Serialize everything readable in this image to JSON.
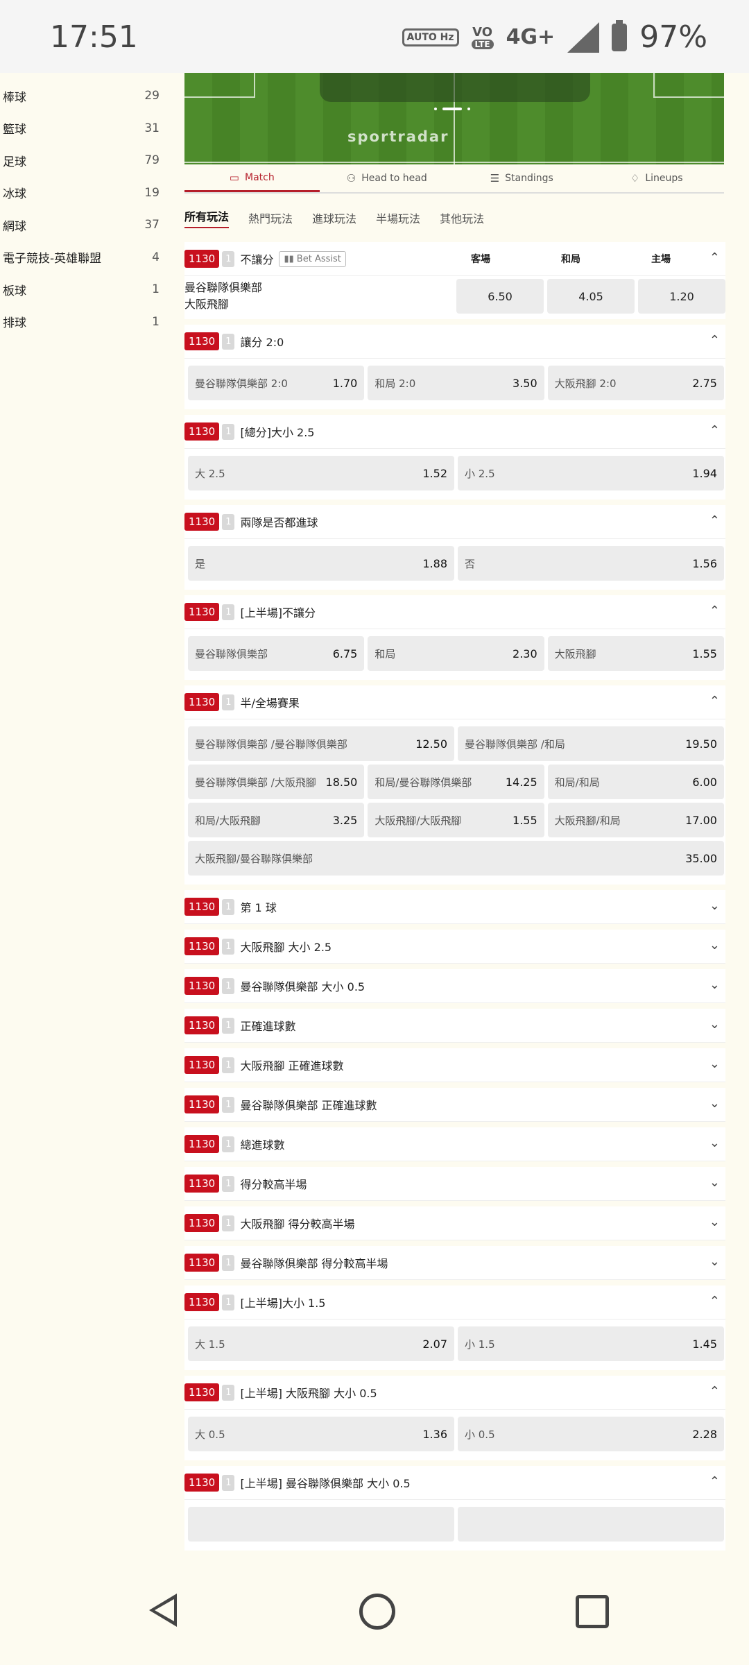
{
  "status_bar": {
    "time": "17:51",
    "auto_hz": "AUTO Hz",
    "vo_lte": "VO",
    "lte": "LTE",
    "network": "4G+",
    "battery": "97%"
  },
  "sidebar": {
    "items": [
      {
        "label": "棒球",
        "count": "29"
      },
      {
        "label": "籃球",
        "count": "31"
      },
      {
        "label": "足球",
        "count": "79"
      },
      {
        "label": "冰球",
        "count": "19"
      },
      {
        "label": "網球",
        "count": "37"
      },
      {
        "label": "電子競技-英雄聯盟",
        "count": "4"
      },
      {
        "label": "板球",
        "count": "1"
      },
      {
        "label": "排球",
        "count": "1"
      }
    ]
  },
  "tracker": {
    "brand": "sportradar"
  },
  "tabs": [
    {
      "label": "Match",
      "icon": "pitch-icon"
    },
    {
      "label": "Head to head",
      "icon": "people-icon"
    },
    {
      "label": "Standings",
      "icon": "table-icon"
    },
    {
      "label": "Lineups",
      "icon": "shirt-icon"
    }
  ],
  "categories": [
    "所有玩法",
    "熱門玩法",
    "進球玩法",
    "半場玩法",
    "其他玩法"
  ],
  "match": {
    "code": "1130",
    "num": "1",
    "market": "不讓分",
    "bet_assist": "Bet Assist",
    "columns": [
      "客場",
      "和局",
      "主場"
    ],
    "team1": "曼谷聯隊俱樂部",
    "team2": "大阪飛腳",
    "odds": [
      "6.50",
      "4.05",
      "1.20"
    ]
  },
  "sections": [
    {
      "code": "1130",
      "num": "1",
      "title": "讓分 2:0",
      "open": true,
      "rows": [
        [
          {
            "l": "曼谷聯隊俱樂部 2:0",
            "v": "1.70"
          },
          {
            "l": "和局 2:0",
            "v": "3.50"
          },
          {
            "l": "大阪飛腳 2:0",
            "v": "2.75"
          }
        ]
      ]
    },
    {
      "code": "1130",
      "num": "1",
      "title": "[總分]大小 2.5",
      "open": true,
      "rows": [
        [
          {
            "l": "大 2.5",
            "v": "1.52"
          },
          {
            "l": "小 2.5",
            "v": "1.94"
          }
        ]
      ]
    },
    {
      "code": "1130",
      "num": "1",
      "title": "兩隊是否都進球",
      "open": true,
      "rows": [
        [
          {
            "l": "是",
            "v": "1.88"
          },
          {
            "l": "否",
            "v": "1.56"
          }
        ]
      ]
    },
    {
      "code": "1130",
      "num": "1",
      "title": "[上半場]不讓分",
      "open": true,
      "rows": [
        [
          {
            "l": "曼谷聯隊俱樂部",
            "v": "6.75"
          },
          {
            "l": "和局",
            "v": "2.30"
          },
          {
            "l": "大阪飛腳",
            "v": "1.55"
          }
        ]
      ]
    },
    {
      "code": "1130",
      "num": "1",
      "title": "半/全場賽果",
      "open": true,
      "rows": [
        [
          {
            "l": "曼谷聯隊俱樂部 /曼谷聯隊俱樂部",
            "v": "12.50"
          },
          {
            "l": "曼谷聯隊俱樂部 /和局",
            "v": "19.50"
          }
        ],
        [
          {
            "l": "曼谷聯隊俱樂部 /大阪飛腳",
            "v": "18.50"
          },
          {
            "l": "和局/曼谷聯隊俱樂部",
            "v": "14.25"
          },
          {
            "l": "和局/和局",
            "v": "6.00"
          }
        ],
        [
          {
            "l": "和局/大阪飛腳",
            "v": "3.25"
          },
          {
            "l": "大阪飛腳/大阪飛腳",
            "v": "1.55"
          },
          {
            "l": "大阪飛腳/和局",
            "v": "17.00"
          }
        ],
        [
          {
            "l": "大阪飛腳/曼谷聯隊俱樂部",
            "v": "35.00"
          }
        ]
      ]
    },
    {
      "code": "1130",
      "num": "1",
      "title": "第 1 球",
      "open": false,
      "rows": []
    },
    {
      "code": "1130",
      "num": "1",
      "title": "大阪飛腳 大小 2.5",
      "open": false,
      "rows": []
    },
    {
      "code": "1130",
      "num": "1",
      "title": "曼谷聯隊俱樂部 大小 0.5",
      "open": false,
      "rows": []
    },
    {
      "code": "1130",
      "num": "1",
      "title": "正確進球數",
      "open": false,
      "rows": []
    },
    {
      "code": "1130",
      "num": "1",
      "title": "大阪飛腳 正確進球數",
      "open": false,
      "rows": []
    },
    {
      "code": "1130",
      "num": "1",
      "title": "曼谷聯隊俱樂部 正確進球數",
      "open": false,
      "rows": []
    },
    {
      "code": "1130",
      "num": "1",
      "title": "總進球數",
      "open": false,
      "rows": []
    },
    {
      "code": "1130",
      "num": "1",
      "title": "得分較高半場",
      "open": false,
      "rows": []
    },
    {
      "code": "1130",
      "num": "1",
      "title": "大阪飛腳 得分較高半場",
      "open": false,
      "rows": []
    },
    {
      "code": "1130",
      "num": "1",
      "title": "曼谷聯隊俱樂部 得分較高半場",
      "open": false,
      "rows": []
    },
    {
      "code": "1130",
      "num": "1",
      "title": "[上半場]大小 1.5",
      "open": true,
      "rows": [
        [
          {
            "l": "大 1.5",
            "v": "2.07"
          },
          {
            "l": "小 1.5",
            "v": "1.45"
          }
        ]
      ]
    },
    {
      "code": "1130",
      "num": "1",
      "title": "[上半場] 大阪飛腳 大小 0.5",
      "open": true,
      "rows": [
        [
          {
            "l": "大 0.5",
            "v": "1.36"
          },
          {
            "l": "小 0.5",
            "v": "2.28"
          }
        ]
      ]
    },
    {
      "code": "1130",
      "num": "1",
      "title": "[上半場] 曼谷聯隊俱樂部 大小 0.5",
      "open": true,
      "rows": [
        [
          {
            "l": "",
            "v": ""
          },
          {
            "l": "",
            "v": ""
          }
        ]
      ]
    }
  ],
  "colors": {
    "accent": "#b51e2a",
    "badge": "#c8101e",
    "background": "#fdfbf0"
  }
}
